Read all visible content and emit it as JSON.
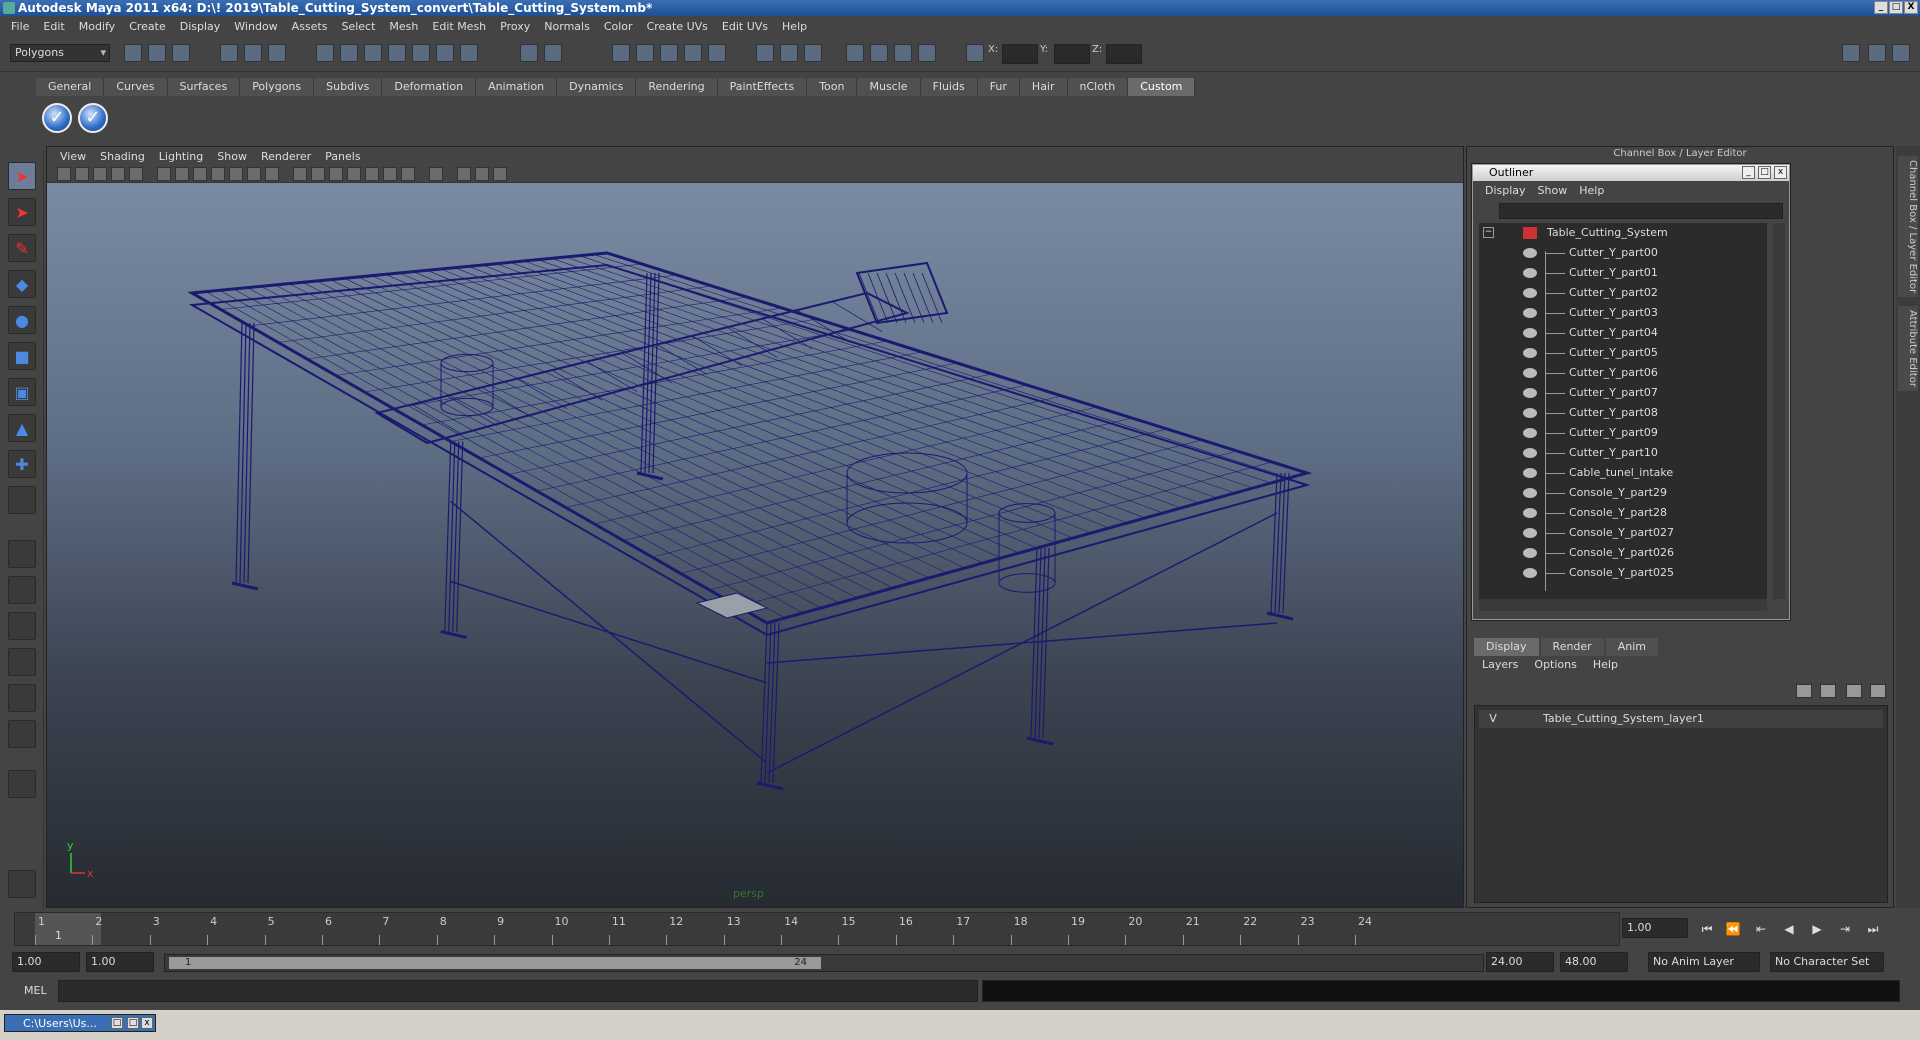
{
  "window": {
    "title": "Autodesk Maya 2011 x64: D:\\! 2019\\Table_Cutting_System_convert\\Table_Cutting_System.mb*",
    "minimize": "_",
    "maximize": "□",
    "close": "X"
  },
  "menus": [
    "File",
    "Edit",
    "Modify",
    "Create",
    "Display",
    "Window",
    "Assets",
    "Select",
    "Mesh",
    "Edit Mesh",
    "Proxy",
    "Normals",
    "Color",
    "Create UVs",
    "Edit UVs",
    "Help"
  ],
  "statusline": {
    "mode": "Polygons",
    "x_label": "X:",
    "y_label": "Y:",
    "z_label": "Z:"
  },
  "shelf": {
    "tabs": [
      "General",
      "Curves",
      "Surfaces",
      "Polygons",
      "Subdivs",
      "Deformation",
      "Animation",
      "Dynamics",
      "Rendering",
      "PaintEffects",
      "Toon",
      "Muscle",
      "Fluids",
      "Fur",
      "Hair",
      "nCloth",
      "Custom"
    ],
    "active_tab": "Custom"
  },
  "viewport": {
    "menus": [
      "View",
      "Shading",
      "Lighting",
      "Show",
      "Renderer",
      "Panels"
    ],
    "camera": "persp",
    "wire_color": "#1a1a6e",
    "axis_x": "x",
    "axis_y": "y"
  },
  "right_panel": {
    "header": "Channel Box / Layer Editor",
    "vertical_tabs": [
      "Channel Box / Layer Editor",
      "Attribute Editor"
    ]
  },
  "outliner": {
    "title": "Outliner",
    "menus": [
      "Display",
      "Show",
      "Help"
    ],
    "root": "Table_Cutting_System",
    "items": [
      "Cutter_Y_part00",
      "Cutter_Y_part01",
      "Cutter_Y_part02",
      "Cutter_Y_part03",
      "Cutter_Y_part04",
      "Cutter_Y_part05",
      "Cutter_Y_part06",
      "Cutter_Y_part07",
      "Cutter_Y_part08",
      "Cutter_Y_part09",
      "Cutter_Y_part10",
      "Cable_tunel_intake",
      "Console_Y_part29",
      "Console_Y_part28",
      "Console_Y_part027",
      "Console_Y_part026",
      "Console_Y_part025"
    ]
  },
  "layer_editor": {
    "tabs": [
      "Display",
      "Render",
      "Anim"
    ],
    "active_tab": "Display",
    "menus": [
      "Layers",
      "Options",
      "Help"
    ],
    "layers": [
      {
        "visible": "V",
        "name": "Table_Cutting_System_layer1"
      }
    ]
  },
  "timeline": {
    "ticks": [
      "1",
      "2",
      "3",
      "4",
      "5",
      "6",
      "7",
      "8",
      "9",
      "10",
      "11",
      "12",
      "13",
      "14",
      "15",
      "16",
      "17",
      "18",
      "19",
      "20",
      "21",
      "22",
      "23",
      "24"
    ],
    "current_frame": "1.00",
    "current_frame_marker": "1"
  },
  "range": {
    "start": "1.00",
    "playback_start": "1.00",
    "slider_start": "1",
    "slider_end": "24",
    "playback_end": "24.00",
    "end": "48.00",
    "anim_layer": "No Anim Layer",
    "character_set": "No Character Set"
  },
  "command_line": {
    "label": "MEL"
  },
  "taskbar": {
    "item": "C:\\Users\\Us..."
  }
}
